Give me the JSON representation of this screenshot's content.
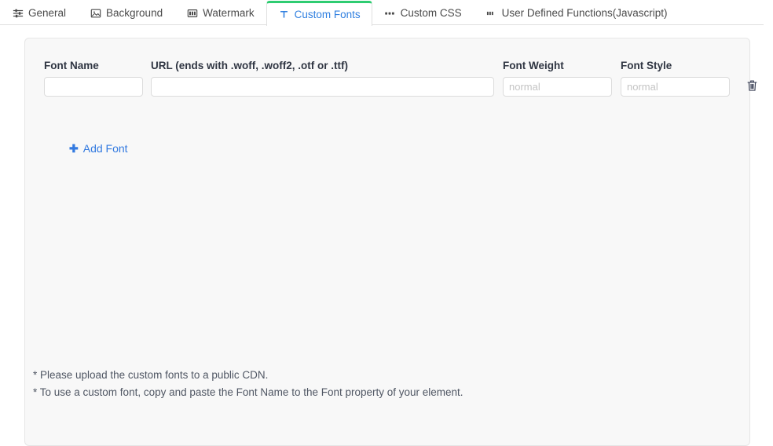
{
  "tabs": [
    {
      "label": "General",
      "icon": "sliders-icon",
      "active": false
    },
    {
      "label": "Background",
      "icon": "image-icon",
      "active": false
    },
    {
      "label": "Watermark",
      "icon": "watermark-icon",
      "active": false
    },
    {
      "label": "Custom Fonts",
      "icon": "text-t-icon",
      "active": true
    },
    {
      "label": "Custom CSS",
      "icon": "css-icon",
      "active": false
    },
    {
      "label": "User Defined Functions(Javascript)",
      "icon": "js-icon",
      "active": false
    }
  ],
  "fonts_table": {
    "headers": {
      "font_name": "Font Name",
      "url": "URL (ends with .woff, .woff2, .otf or .ttf)",
      "font_weight": "Font Weight",
      "font_style": "Font Style"
    },
    "row": {
      "font_name_value": "",
      "font_name_placeholder": "",
      "url_value": "",
      "url_placeholder": "",
      "font_weight_value": "",
      "font_weight_placeholder": "normal",
      "font_style_value": "",
      "font_style_placeholder": "normal",
      "delete_icon": "trash-icon"
    }
  },
  "add_font": {
    "label": "Add Font",
    "icon": "plus-icon"
  },
  "notes": [
    "* Please upload the custom fonts to a public CDN.",
    "* To use a custom font, copy and paste the Font Name to the Font property of your element."
  ],
  "colors": {
    "accent_blue": "#337ae0",
    "active_tab_top": "#2ecc71",
    "card_bg": "#f8f8f8",
    "page_bg": "#ffffff",
    "border": "#e0e0e0",
    "text": "#3c4257",
    "placeholder": "#c4c4c4"
  }
}
